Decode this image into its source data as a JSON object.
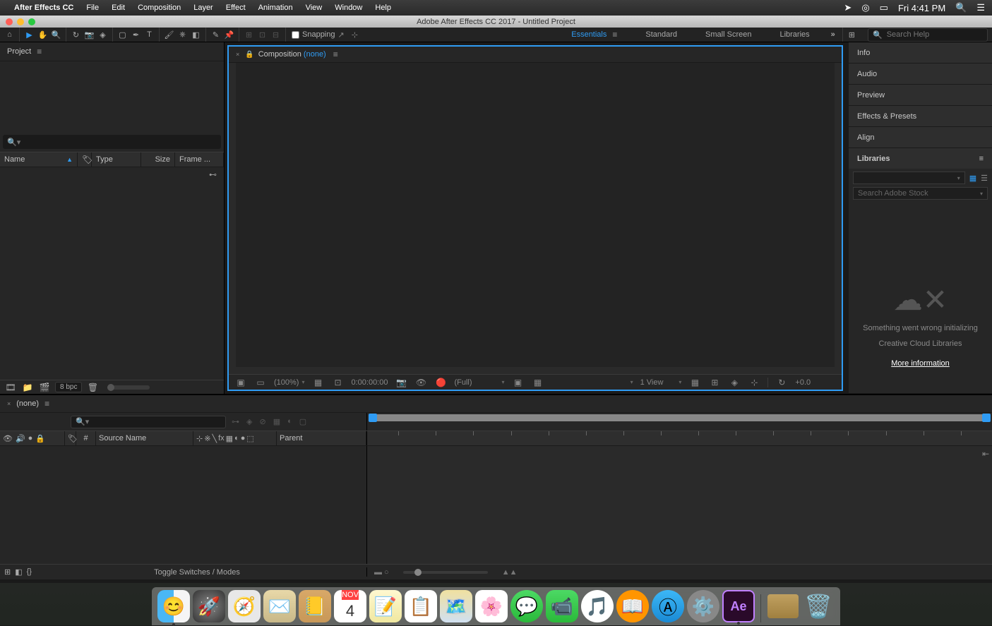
{
  "mac_menu": {
    "app_name": "After Effects CC",
    "items": [
      "File",
      "Edit",
      "Composition",
      "Layer",
      "Effect",
      "Animation",
      "View",
      "Window",
      "Help"
    ],
    "clock": "Fri 4:41 PM"
  },
  "title_bar": {
    "title": "Adobe After Effects CC 2017 - Untitled Project"
  },
  "tool_bar": {
    "snapping_label": "Snapping",
    "workspaces": [
      "Essentials",
      "Standard",
      "Small Screen",
      "Libraries"
    ],
    "search_placeholder": "Search Help"
  },
  "project_panel": {
    "title": "Project",
    "columns": {
      "name": "Name",
      "type": "Type",
      "size": "Size",
      "frame": "Frame ..."
    },
    "bpc": "8 bpc"
  },
  "comp_panel": {
    "title_prefix": "Composition",
    "title_none": "(none)",
    "footer": {
      "zoom": "(100%)",
      "time": "0:00:00:00",
      "resolution": "(Full)",
      "view": "1 View",
      "exposure": "+0.0"
    }
  },
  "right_panels": {
    "items": [
      "Info",
      "Audio",
      "Preview",
      "Effects & Presets",
      "Align",
      "Libraries"
    ],
    "libraries": {
      "search_placeholder": "Search Adobe Stock",
      "error_line1": "Something went wrong initializing",
      "error_line2": "Creative Cloud Libraries",
      "more_info": "More information"
    }
  },
  "timeline": {
    "title": "(none)",
    "columns": {
      "num": "#",
      "source_name": "Source Name",
      "parent": "Parent"
    },
    "toggle_label": "Toggle Switches / Modes"
  },
  "dock": {
    "cal_month": "NOV",
    "cal_day": "4",
    "ae_label": "Ae"
  }
}
